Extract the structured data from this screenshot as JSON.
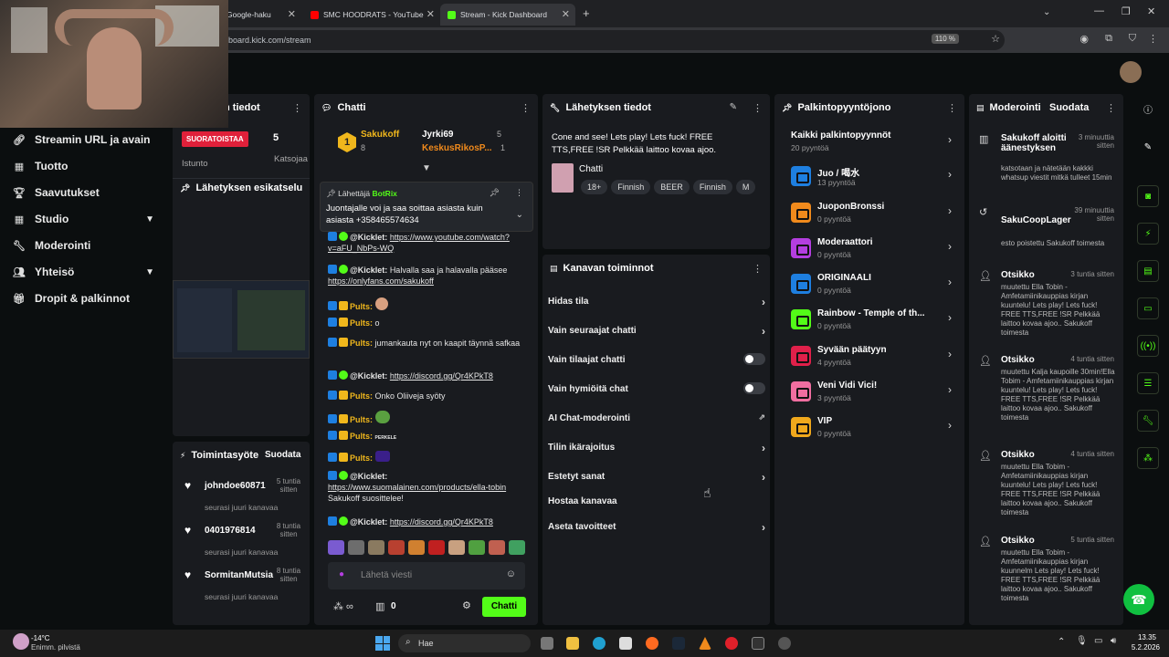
{
  "browser": {
    "tabs": [
      {
        "title": "Google-haku"
      },
      {
        "title": "SMC HOODRATS - YouTube"
      },
      {
        "title": "Stream - Kick Dashboard"
      }
    ],
    "url": "board.kick.com/stream",
    "zoom": "110 %"
  },
  "nav": {
    "items": [
      {
        "label": "Streamin URL ja avain"
      },
      {
        "label": "Tuotto"
      },
      {
        "label": "Saavutukset"
      },
      {
        "label": "Studio"
      },
      {
        "label": "Moderointi"
      },
      {
        "label": "Yhteisö"
      },
      {
        "label": "Dropit & palkinnot"
      }
    ]
  },
  "stream_info": {
    "title": "n tiedot",
    "live_badge": "SUORATOISTAA",
    "viewers": "5",
    "col1": "Istunto",
    "col2": "Katsojaa",
    "preview_title": "Lähetyksen esikatselu"
  },
  "activity": {
    "title": "Toimintasyöte",
    "filter": "Suodata",
    "items": [
      {
        "name": "johndoe60871",
        "time": "5 tuntia sitten",
        "sub": "seurasi juuri kanavaa"
      },
      {
        "name": "0401976814",
        "time": "8 tuntia sitten",
        "sub": "seurasi juuri kanavaa"
      },
      {
        "name": "SormitanMutsia",
        "time": "8 tuntia sitten",
        "sub": "seurasi juuri kanavaa"
      }
    ]
  },
  "chat": {
    "title": "Chatti",
    "top": [
      {
        "rank": "1",
        "name": "Sakukoff",
        "count": "8"
      },
      {
        "name": "Jyrki69",
        "count": "5"
      },
      {
        "name": "KeskusRikosP...",
        "count": "1"
      }
    ],
    "pinned": {
      "by_label": "Lähettäjä",
      "by": "BotRix",
      "text": "Juontajalle voi ja saa soittaa asiasta kuin asiasta +358465574634"
    },
    "messages": [
      {
        "user": "@Kicklet:",
        "text": "https://www.youtube.com/watch?v=aFU_NbPs-WQ"
      },
      {
        "user": "@Kicklet:",
        "text": "Halvalla saa ja halavalla pääsee ",
        "link": "https://onlyfans.com/sakukoff"
      },
      {
        "user": "Pults:",
        "text": ""
      },
      {
        "user": "Pults:",
        "text": "o"
      },
      {
        "user": "Pults:",
        "text": "jumankauta nyt on kaapit täynnä safkaa"
      },
      {
        "user": "@Kicklet:",
        "text": "https://discord.gg/Qr4KPkT8"
      },
      {
        "user": "Pults:",
        "text": "Onko Oliiveja syöty"
      },
      {
        "user": "Pults:",
        "text": ""
      },
      {
        "user": "Pults:",
        "text": "PERKELE"
      },
      {
        "user": "Pults:",
        "text": ""
      },
      {
        "user": "@Kicklet:",
        "text": "https://www.suomalainen.com/products/ella-tobin",
        "extra": "Sakukoff suosittelee!"
      },
      {
        "user": "@Kicklet:",
        "text": "https://discord.gg/Qr4KPkT8"
      }
    ],
    "input_placeholder": "Lähetä viesti",
    "points": "0",
    "send_label": "Chatti"
  },
  "broadcast": {
    "title": "Lähetyksen tiedot",
    "stream_title": "Cone and see! Lets play! Lets fuck! FREE TTS,FREE !SR Pelkkää laittoo kovaa ajoo.",
    "category": "Chatti",
    "tags": [
      "18+",
      "Finnish",
      "BEER",
      "Finnish",
      "M"
    ]
  },
  "channel_actions": {
    "title": "Kanavan toiminnot",
    "items": [
      {
        "label": "Hidas tila",
        "kind": "arrow"
      },
      {
        "label": "Vain seuraajat chatti",
        "kind": "arrow"
      },
      {
        "label": "Vain tilaajat chatti",
        "kind": "toggle"
      },
      {
        "label": "Vain hymiöitä chat",
        "kind": "toggle"
      },
      {
        "label": "AI Chat-moderointi",
        "kind": "ext"
      },
      {
        "label": "Tilin ikärajoitus",
        "kind": "arrow"
      },
      {
        "label": "Estetyt sanat",
        "kind": "arrow"
      },
      {
        "label": "Hostaa kanavaa",
        "kind": "none"
      },
      {
        "label": "Aseta tavoitteet",
        "kind": "arrow"
      }
    ]
  },
  "rewards": {
    "title": "Palkintopyyntöjono",
    "all_label": "Kaikki palkintopyynnöt",
    "all_count": "20 pyyntöä",
    "items": [
      {
        "name": "Juo / 喝水",
        "count": "13 pyyntöä",
        "color": "#1e7fe0"
      },
      {
        "name": "JuoponBronssi",
        "count": "0 pyyntöä",
        "color": "#f08a1c"
      },
      {
        "name": "Moderaattori",
        "count": "0 pyyntöä",
        "color": "#b43ee0"
      },
      {
        "name": "ORIGINAALI",
        "count": "0 pyyntöä",
        "color": "#1e7fe0"
      },
      {
        "name": "Rainbow - Temple of th...",
        "count": "0 pyyntöä",
        "color": "#53fc18"
      },
      {
        "name": "Syvään päätyyn",
        "count": "4 pyyntöä",
        "color": "#e0204a"
      },
      {
        "name": "Veni Vidi Vici!",
        "count": "3 pyyntöä",
        "color": "#f06ea0"
      },
      {
        "name": "VIP",
        "count": "0 pyyntöä",
        "color": "#f0a81c"
      }
    ]
  },
  "moderation": {
    "title": "Moderointi",
    "filter": "Suodata",
    "items": [
      {
        "title": "Sakukoff aloitti äänestyksen",
        "time": "3 minuuttia sitten",
        "body": "katsotaan ja nätetään kakkki whatsup viestit mitkä tulleet 15min"
      },
      {
        "title": "SakuCoopLager",
        "time": "39 minuuttia sitten",
        "body": "esto poistettu Sakukoff toimesta"
      },
      {
        "title": "Otsikko",
        "time": "3 tuntia sitten",
        "body": "muutettu Ella Tobin - Amfetamiinikauppias kirjan kuuntelu! Lets play! Lets fuck! FREE TTS,FREE !SR Pelkkää laittoo kovaa ajoo.. Sakukoff toimesta"
      },
      {
        "title": "Otsikko",
        "time": "4 tuntia sitten",
        "body": "muutettu Kalja kaupoille 30min!Ella Tobim - Amfetamiinikauppias kirjan kuuntelu! Lets play! Lets fuck! FREE TTS,FREE !SR Pelkkää laittoo kovaa ajoo.. Sakukoff toimesta"
      },
      {
        "title": "Otsikko",
        "time": "4 tuntia sitten",
        "body": "muutettu Ella Tobim - Amfetamiinikauppias kirjan kuuntelu! Lets play! Lets fuck! FREE TTS,FREE !SR Pelkkää laittoo kovaa ajoo.. Sakukoff toimesta"
      },
      {
        "title": "Otsikko",
        "time": "5 tuntia sitten",
        "body": "muutettu Ella Tobim - Amfetamiinikauppias kirjan kuunnelm Lets play! Lets fuck! FREE TTS,FREE !SR Pelkkää laittoo kovaa ajoo.. Sakukoff toimesta"
      }
    ]
  },
  "taskbar": {
    "weather_temp": "-14°C",
    "weather_desc": "Enimm. pilvistä",
    "search": "Hae",
    "time": "13.35",
    "date": "5.2.2026"
  },
  "colors": {
    "kick_green": "#53fc18",
    "panel": "#191b1f",
    "live_red": "#e0203a"
  }
}
